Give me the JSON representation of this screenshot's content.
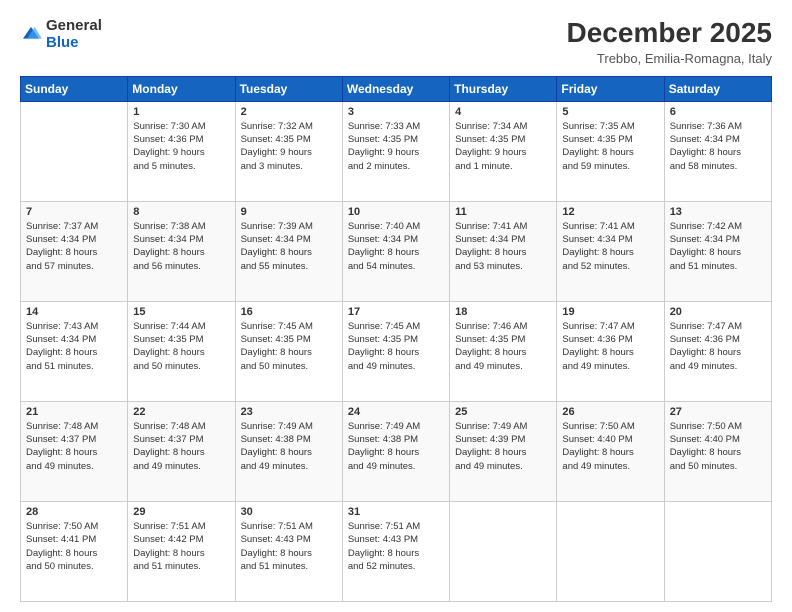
{
  "header": {
    "logo": {
      "general": "General",
      "blue": "Blue"
    },
    "title": "December 2025",
    "location": "Trebbo, Emilia-Romagna, Italy"
  },
  "weekdays": [
    "Sunday",
    "Monday",
    "Tuesday",
    "Wednesday",
    "Thursday",
    "Friday",
    "Saturday"
  ],
  "weeks": [
    [
      {
        "day": "",
        "info": ""
      },
      {
        "day": "1",
        "info": "Sunrise: 7:30 AM\nSunset: 4:36 PM\nDaylight: 9 hours\nand 5 minutes."
      },
      {
        "day": "2",
        "info": "Sunrise: 7:32 AM\nSunset: 4:35 PM\nDaylight: 9 hours\nand 3 minutes."
      },
      {
        "day": "3",
        "info": "Sunrise: 7:33 AM\nSunset: 4:35 PM\nDaylight: 9 hours\nand 2 minutes."
      },
      {
        "day": "4",
        "info": "Sunrise: 7:34 AM\nSunset: 4:35 PM\nDaylight: 9 hours\nand 1 minute."
      },
      {
        "day": "5",
        "info": "Sunrise: 7:35 AM\nSunset: 4:35 PM\nDaylight: 8 hours\nand 59 minutes."
      },
      {
        "day": "6",
        "info": "Sunrise: 7:36 AM\nSunset: 4:34 PM\nDaylight: 8 hours\nand 58 minutes."
      }
    ],
    [
      {
        "day": "7",
        "info": "Sunrise: 7:37 AM\nSunset: 4:34 PM\nDaylight: 8 hours\nand 57 minutes."
      },
      {
        "day": "8",
        "info": "Sunrise: 7:38 AM\nSunset: 4:34 PM\nDaylight: 8 hours\nand 56 minutes."
      },
      {
        "day": "9",
        "info": "Sunrise: 7:39 AM\nSunset: 4:34 PM\nDaylight: 8 hours\nand 55 minutes."
      },
      {
        "day": "10",
        "info": "Sunrise: 7:40 AM\nSunset: 4:34 PM\nDaylight: 8 hours\nand 54 minutes."
      },
      {
        "day": "11",
        "info": "Sunrise: 7:41 AM\nSunset: 4:34 PM\nDaylight: 8 hours\nand 53 minutes."
      },
      {
        "day": "12",
        "info": "Sunrise: 7:41 AM\nSunset: 4:34 PM\nDaylight: 8 hours\nand 52 minutes."
      },
      {
        "day": "13",
        "info": "Sunrise: 7:42 AM\nSunset: 4:34 PM\nDaylight: 8 hours\nand 51 minutes."
      }
    ],
    [
      {
        "day": "14",
        "info": "Sunrise: 7:43 AM\nSunset: 4:34 PM\nDaylight: 8 hours\nand 51 minutes."
      },
      {
        "day": "15",
        "info": "Sunrise: 7:44 AM\nSunset: 4:35 PM\nDaylight: 8 hours\nand 50 minutes."
      },
      {
        "day": "16",
        "info": "Sunrise: 7:45 AM\nSunset: 4:35 PM\nDaylight: 8 hours\nand 50 minutes."
      },
      {
        "day": "17",
        "info": "Sunrise: 7:45 AM\nSunset: 4:35 PM\nDaylight: 8 hours\nand 49 minutes."
      },
      {
        "day": "18",
        "info": "Sunrise: 7:46 AM\nSunset: 4:35 PM\nDaylight: 8 hours\nand 49 minutes."
      },
      {
        "day": "19",
        "info": "Sunrise: 7:47 AM\nSunset: 4:36 PM\nDaylight: 8 hours\nand 49 minutes."
      },
      {
        "day": "20",
        "info": "Sunrise: 7:47 AM\nSunset: 4:36 PM\nDaylight: 8 hours\nand 49 minutes."
      }
    ],
    [
      {
        "day": "21",
        "info": "Sunrise: 7:48 AM\nSunset: 4:37 PM\nDaylight: 8 hours\nand 49 minutes."
      },
      {
        "day": "22",
        "info": "Sunrise: 7:48 AM\nSunset: 4:37 PM\nDaylight: 8 hours\nand 49 minutes."
      },
      {
        "day": "23",
        "info": "Sunrise: 7:49 AM\nSunset: 4:38 PM\nDaylight: 8 hours\nand 49 minutes."
      },
      {
        "day": "24",
        "info": "Sunrise: 7:49 AM\nSunset: 4:38 PM\nDaylight: 8 hours\nand 49 minutes."
      },
      {
        "day": "25",
        "info": "Sunrise: 7:49 AM\nSunset: 4:39 PM\nDaylight: 8 hours\nand 49 minutes."
      },
      {
        "day": "26",
        "info": "Sunrise: 7:50 AM\nSunset: 4:40 PM\nDaylight: 8 hours\nand 49 minutes."
      },
      {
        "day": "27",
        "info": "Sunrise: 7:50 AM\nSunset: 4:40 PM\nDaylight: 8 hours\nand 50 minutes."
      }
    ],
    [
      {
        "day": "28",
        "info": "Sunrise: 7:50 AM\nSunset: 4:41 PM\nDaylight: 8 hours\nand 50 minutes."
      },
      {
        "day": "29",
        "info": "Sunrise: 7:51 AM\nSunset: 4:42 PM\nDaylight: 8 hours\nand 51 minutes."
      },
      {
        "day": "30",
        "info": "Sunrise: 7:51 AM\nSunset: 4:43 PM\nDaylight: 8 hours\nand 51 minutes."
      },
      {
        "day": "31",
        "info": "Sunrise: 7:51 AM\nSunset: 4:43 PM\nDaylight: 8 hours\nand 52 minutes."
      },
      {
        "day": "",
        "info": ""
      },
      {
        "day": "",
        "info": ""
      },
      {
        "day": "",
        "info": ""
      }
    ]
  ]
}
